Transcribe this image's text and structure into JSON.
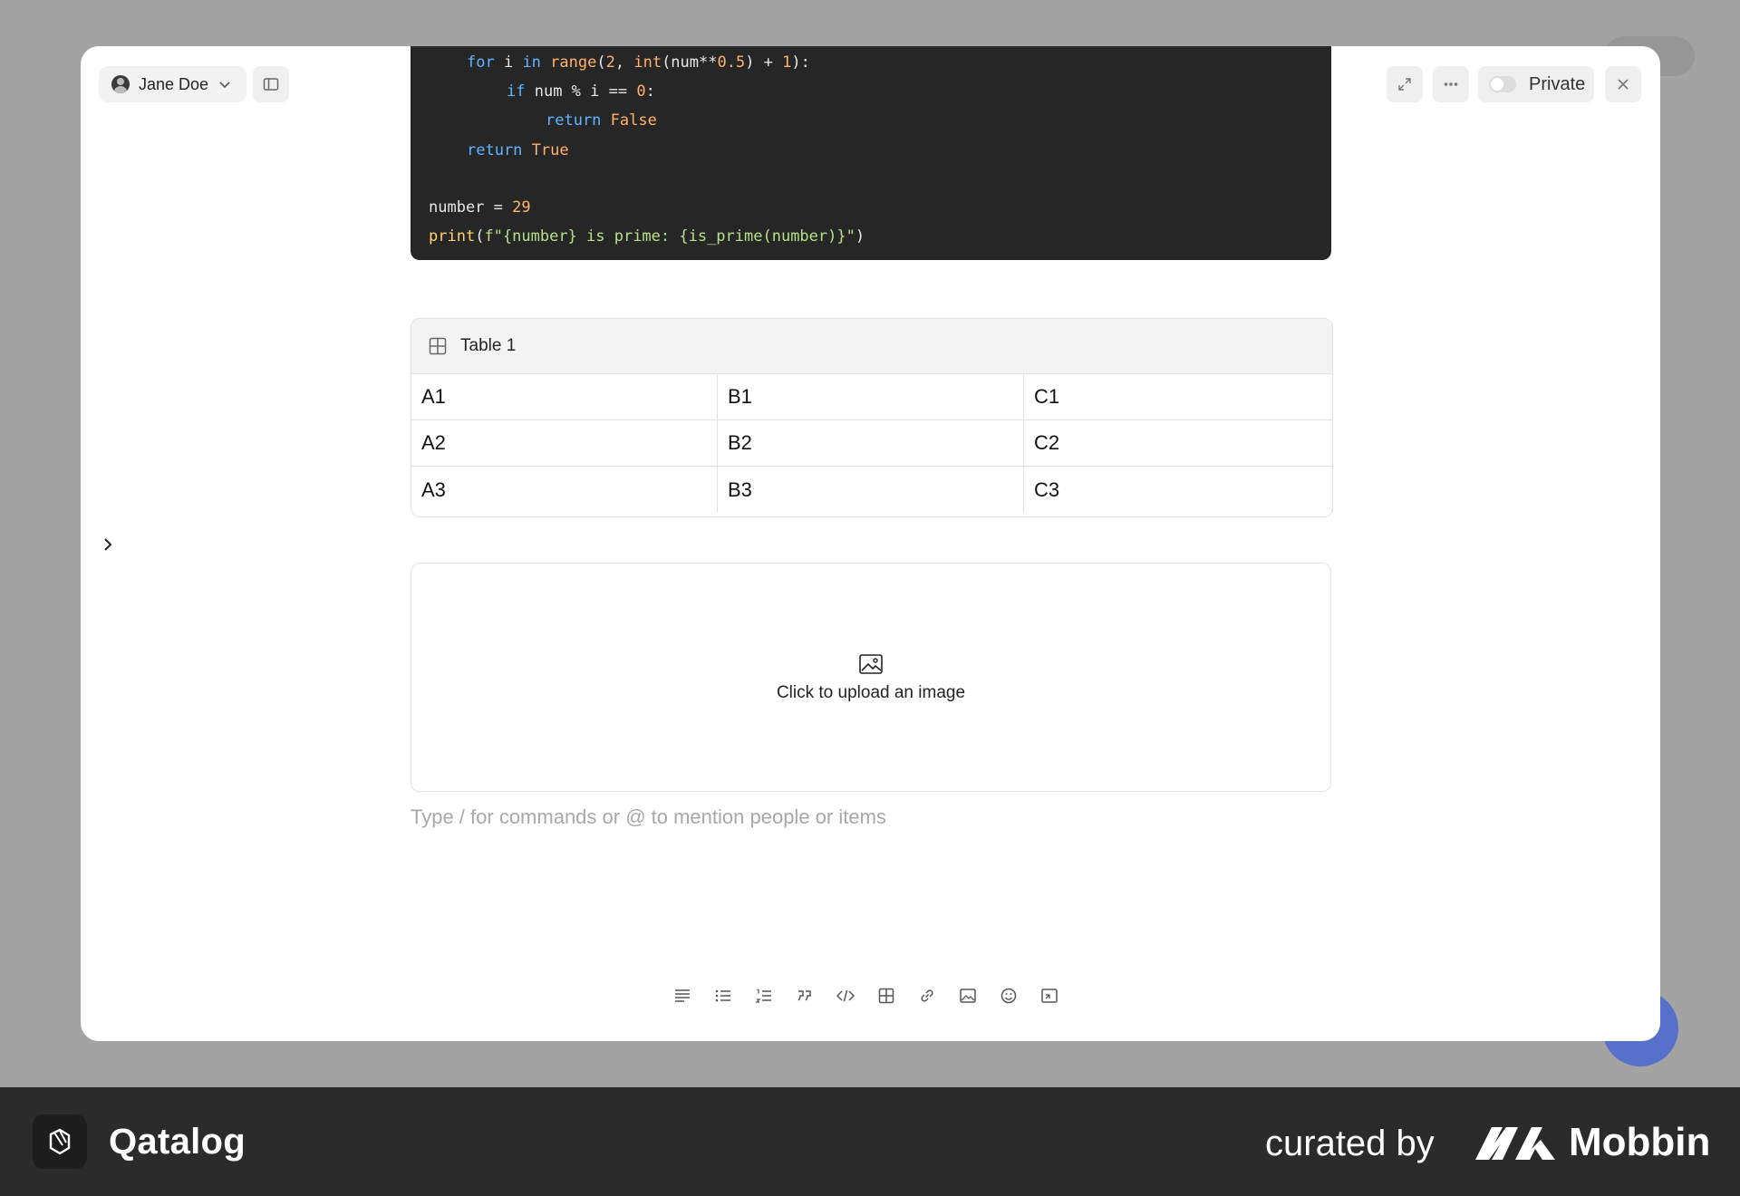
{
  "header": {
    "user_name": "Jane Doe",
    "privacy_label": "Private"
  },
  "code_block": {
    "lines": [
      "for i in range(2, int(num**0.5) + 1):",
      "if num % i == 0:",
      "return False",
      "return True",
      "number = 29",
      "print(f\"{number} is prime: {is_prime(number)}\")"
    ]
  },
  "table": {
    "title": "Table 1",
    "rows": [
      [
        "A1",
        "B1",
        "C1"
      ],
      [
        "A2",
        "B2",
        "C2"
      ],
      [
        "A3",
        "B3",
        "C3"
      ]
    ]
  },
  "upload": {
    "label": "Click to upload an image"
  },
  "editor": {
    "placeholder": "Type / for commands or @ to mention people or items"
  },
  "toolbar": {
    "tools": [
      "align-text-icon",
      "bullet-list-icon",
      "numbered-list-icon",
      "quote-icon",
      "code-icon",
      "table-icon",
      "link-icon",
      "image-icon",
      "emoji-icon",
      "embed-icon"
    ]
  },
  "footer": {
    "brand": "Qatalog",
    "curated_by": "curated by",
    "curator": "Mobbin"
  }
}
